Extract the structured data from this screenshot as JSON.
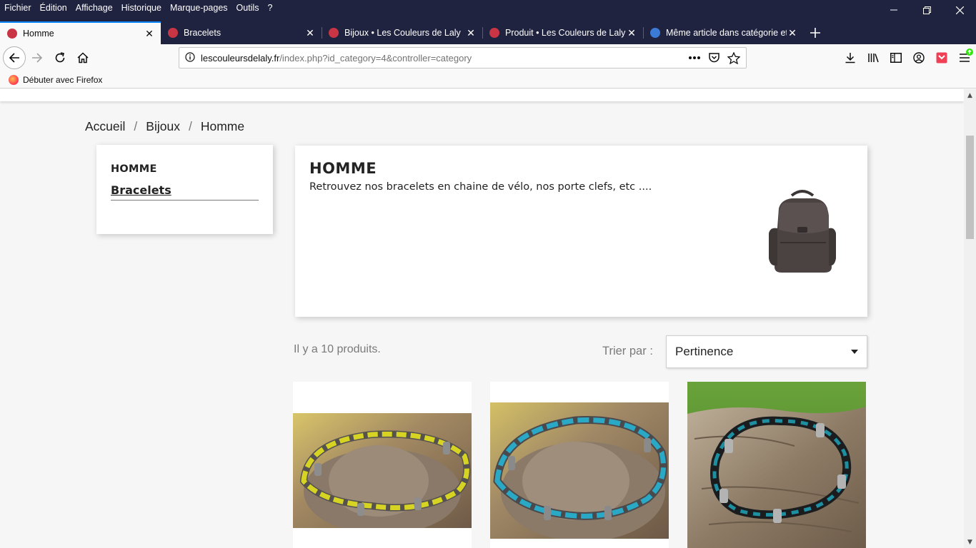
{
  "menu": {
    "items": [
      "Fichier",
      "Édition",
      "Affichage",
      "Historique",
      "Marque-pages",
      "Outils",
      "?"
    ]
  },
  "tabs": [
    {
      "title": "Homme",
      "active": true,
      "favicon_color": "#c93545"
    },
    {
      "title": "Bracelets",
      "active": false,
      "favicon_color": "#c93545"
    },
    {
      "title": "Bijoux • Les Couleurs de Laly",
      "active": false,
      "favicon_color": "#c93545"
    },
    {
      "title": "Produit • Les Couleurs de Laly",
      "active": false,
      "favicon_color": "#c93545"
    },
    {
      "title": "Même article dans catégorie et",
      "active": false,
      "favicon_color": "#3b7bd6"
    }
  ],
  "urlbar": {
    "domain": "lescouleursdelaly.fr",
    "path": "/index.php?id_category=4&controller=category"
  },
  "bookmarks": [
    {
      "label": "Débuter avec Firefox"
    }
  ],
  "breadcrumb": [
    "Accueil",
    "Bijoux",
    "Homme"
  ],
  "sidebar": {
    "title": "HOMME",
    "links": [
      "Bracelets"
    ]
  },
  "category": {
    "title": "HOMME",
    "description": "Retrouvez nos bracelets en chaine de vélo, nos porte clefs, etc ...."
  },
  "listing": {
    "count_text": "Il y a 10 produits.",
    "sort_label": "Trier par :",
    "sort_value": "Pertinence"
  },
  "products": [
    {
      "image": "yellow-bracelet-photo",
      "accent": "#d6d323"
    },
    {
      "image": "turquoise-bracelet-photo",
      "accent": "#2aa9c6"
    },
    {
      "image": "teal-black-bracelet-photo",
      "accent": "#1e8fa0"
    }
  ],
  "colors": {
    "chrome_dark": "#202340",
    "tab_active_accent": "#0a84ff",
    "page_bg": "#f6f6f6"
  }
}
